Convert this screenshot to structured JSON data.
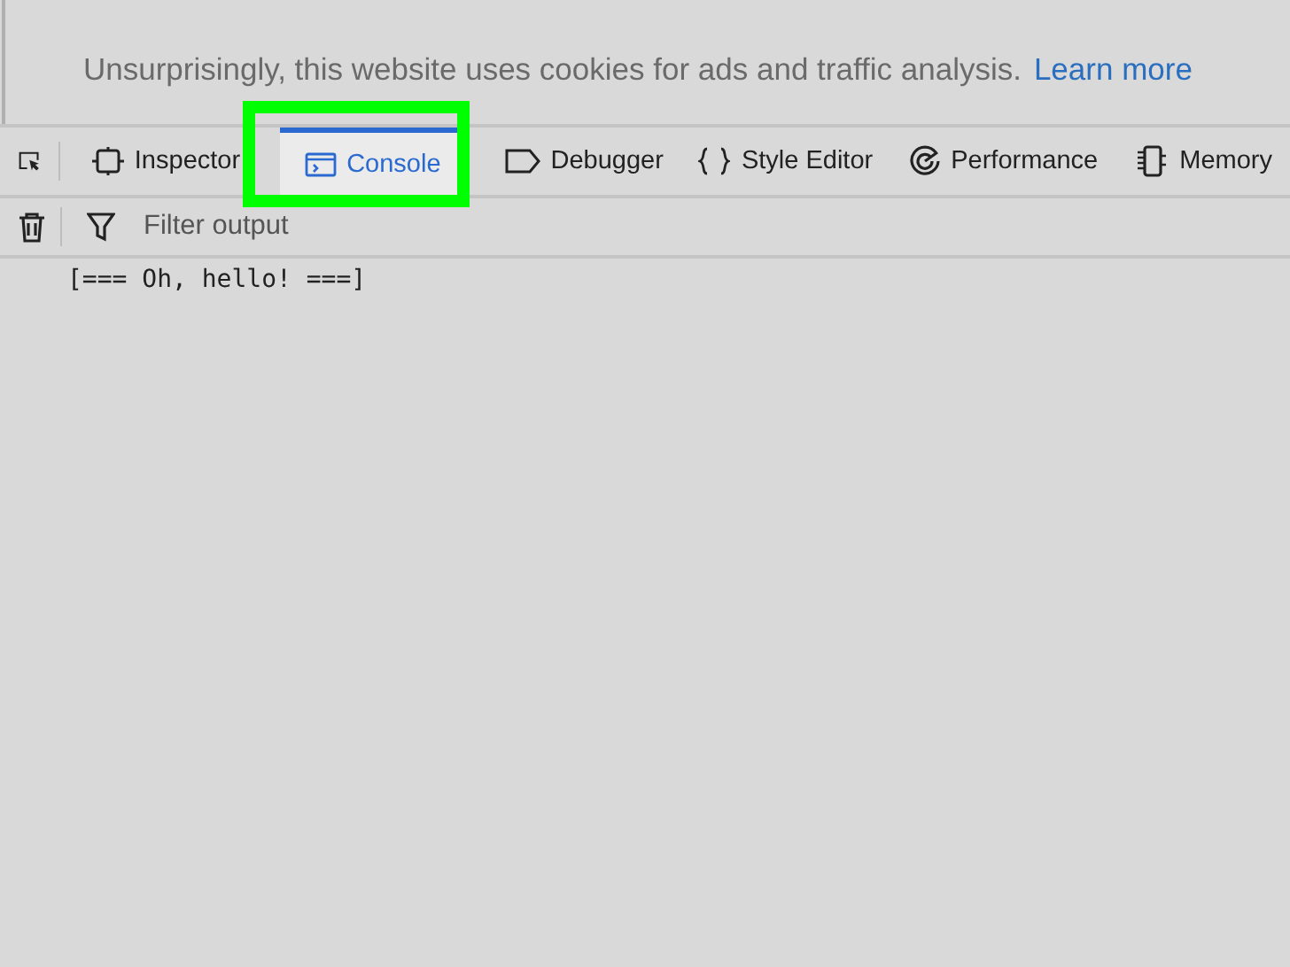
{
  "notice": {
    "text": "Unsurprisingly, this website uses cookies for ads and traffic analysis.",
    "link": "Learn more"
  },
  "tabs": [
    {
      "label": "Inspector",
      "kind": "inspector",
      "selected": false
    },
    {
      "label": "Console",
      "kind": "console",
      "selected": true
    },
    {
      "label": "Debugger",
      "kind": "debugger",
      "selected": false
    },
    {
      "label": "Style Editor",
      "kind": "style",
      "selected": false
    },
    {
      "label": "Performance",
      "kind": "performance",
      "selected": false
    },
    {
      "label": "Memory",
      "kind": "memory",
      "selected": false
    }
  ],
  "filter": {
    "placeholder": "Filter output"
  },
  "console_lines": [
    "[=== Oh, hello! ===]"
  ]
}
